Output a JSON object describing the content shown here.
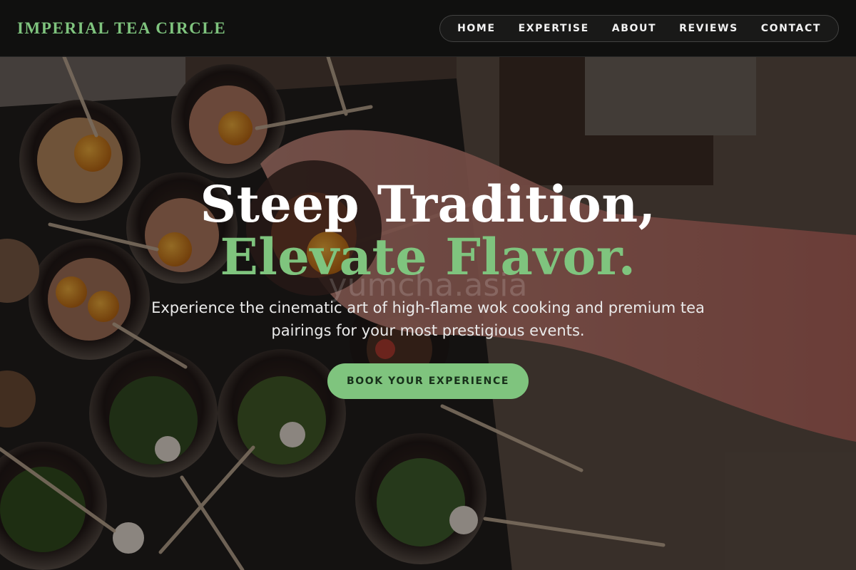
{
  "header": {
    "brand": "IMPERIAL TEA CIRCLE",
    "nav": [
      {
        "label": "HOME"
      },
      {
        "label": "EXPERTISE"
      },
      {
        "label": "ABOUT"
      },
      {
        "label": "REVIEWS"
      },
      {
        "label": "CONTACT"
      }
    ]
  },
  "hero": {
    "title_line1": "Steep Tradition,",
    "title_line2": "Elevate Flavor.",
    "watermark": "yumcha.asia",
    "subtitle": "Experience the cinematic art of high-flame wok cooking and premium tea pairings for your most prestigious events.",
    "cta_label": "BOOK YOUR EXPERIENCE",
    "background_image": "food-cups-on-skewers-photo"
  },
  "colors": {
    "accent": "#7fc47e",
    "header_bg": "#0e0e0e",
    "cta_text": "#17301a"
  }
}
